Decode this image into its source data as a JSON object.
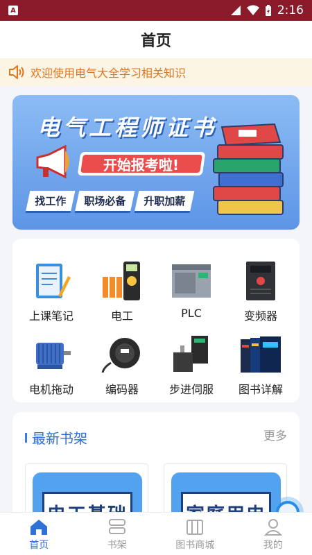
{
  "status_bar": {
    "time": "2:16",
    "app_badge": "A"
  },
  "header": {
    "title": "首页"
  },
  "notice": {
    "text": "欢迎使用电气大全学习相关知识"
  },
  "banner": {
    "title": "电气工程师证书",
    "subtitle": "开始报考啦!",
    "tags": [
      "找工作",
      "职场必备",
      "升职加薪"
    ]
  },
  "grid": {
    "items": [
      {
        "label": "上课笔记",
        "icon": "notebook-icon"
      },
      {
        "label": "电工",
        "icon": "multimeter-icon"
      },
      {
        "label": "PLC",
        "icon": "plc-icon"
      },
      {
        "label": "变频器",
        "icon": "inverter-icon"
      },
      {
        "label": "电机拖动",
        "icon": "motor-icon"
      },
      {
        "label": "编码器",
        "icon": "encoder-icon"
      },
      {
        "label": "步进伺服",
        "icon": "stepper-icon"
      },
      {
        "label": "图书详解",
        "icon": "books-icon"
      }
    ]
  },
  "shelf": {
    "title": "最新书架",
    "more": "更多",
    "books": [
      {
        "title": "电工基础"
      },
      {
        "title": "家庭用电"
      }
    ]
  },
  "tabs": [
    {
      "label": "首页",
      "icon": "home-icon",
      "active": true
    },
    {
      "label": "书架",
      "icon": "shelf-icon",
      "active": false
    },
    {
      "label": "图书商城",
      "icon": "bookstore-icon",
      "active": false
    },
    {
      "label": "我的",
      "icon": "profile-icon",
      "active": false
    }
  ],
  "colors": {
    "status_bar": "#8b1a2b",
    "accent": "#2f6fd8",
    "notice_text": "#e0751f",
    "banner_red": "#ea4b4b"
  }
}
